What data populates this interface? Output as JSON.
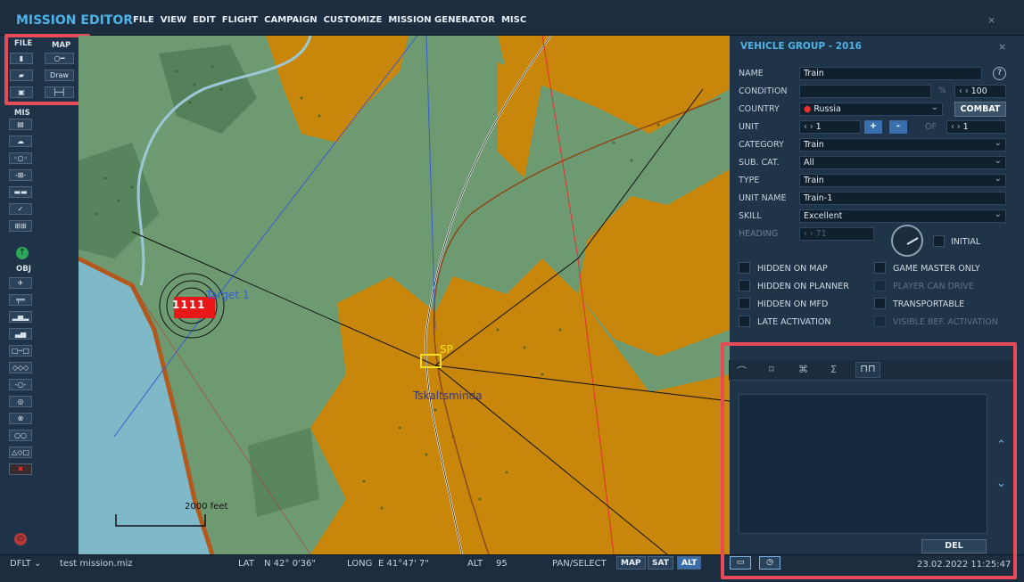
{
  "app": {
    "title": "MISSION EDITOR",
    "close": "×"
  },
  "menu": [
    "FILE",
    "VIEW",
    "EDIT",
    "FLIGHT",
    "CAMPAIGN",
    "CUSTOMIZE",
    "MISSION GENERATOR",
    "MISC"
  ],
  "toolbar": {
    "file_label": "FILE",
    "map_label": "MAP",
    "draw_label": "Draw",
    "mis_label": "MIS",
    "obj_label": "OBJ"
  },
  "map": {
    "target_label": "Target 1",
    "sp_label": "SP",
    "town_label": "Tskaltsminda",
    "scale_label": "2000 feet",
    "unit_numbers": [
      "1",
      "1",
      "1",
      "1"
    ]
  },
  "status": {
    "profile": "DFLT",
    "file": "test mission.miz",
    "lat_label": "LAT",
    "lat_value": "N 42° 0'36\"",
    "long_label": "LONG",
    "long_value": "E 41°47' 7\"",
    "alt_label": "ALT",
    "alt_value": "95",
    "mode": "PAN/SELECT",
    "btn_map": "MAP",
    "btn_sat": "SAT",
    "btn_alt": "ALT",
    "datetime": "23.02.2022 11:25:47"
  },
  "panel": {
    "title": "VEHICLE GROUP - 2016",
    "close": "×",
    "name_label": "NAME",
    "name_value": "Train",
    "help": "?",
    "condition_label": "CONDITION",
    "condition_value": "",
    "percent": "%",
    "condition_pct": "100",
    "country_label": "COUNTRY",
    "country_value": "Russia",
    "combat_btn": "COMBAT",
    "unit_label": "UNIT",
    "unit_value": "1",
    "plus": "+",
    "minus": "-",
    "of_label": "OF",
    "of_value": "1",
    "category_label": "CATEGORY",
    "category_value": "Train",
    "subcat_label": "SUB. CAT.",
    "subcat_value": "All",
    "type_label": "TYPE",
    "type_value": "Train",
    "unitname_label": "UNIT NAME",
    "unitname_value": "Train-1",
    "skill_label": "SKILL",
    "skill_value": "Excellent",
    "heading_label": "HEADING",
    "heading_value": "71",
    "initial_label": "INITIAL",
    "checks": [
      {
        "label": "HIDDEN ON MAP",
        "enabled": true
      },
      {
        "label": "GAME MASTER ONLY",
        "enabled": true
      },
      {
        "label": "HIDDEN ON PLANNER",
        "enabled": true
      },
      {
        "label": "PLAYER CAN DRIVE",
        "enabled": false
      },
      {
        "label": "HIDDEN ON MFD",
        "enabled": true
      },
      {
        "label": "TRANSPORTABLE",
        "enabled": true
      },
      {
        "label": "LATE ACTIVATION",
        "enabled": true
      },
      {
        "label": "VISIBLE BEF. ACTIVATION",
        "enabled": false
      }
    ],
    "del_btn": "DEL"
  },
  "colors": {
    "accent": "#4fb2e6",
    "highlight": "#e84b58",
    "map_green": "#6e9a72",
    "map_orange": "#c8860a",
    "water": "#7fb8c8"
  }
}
